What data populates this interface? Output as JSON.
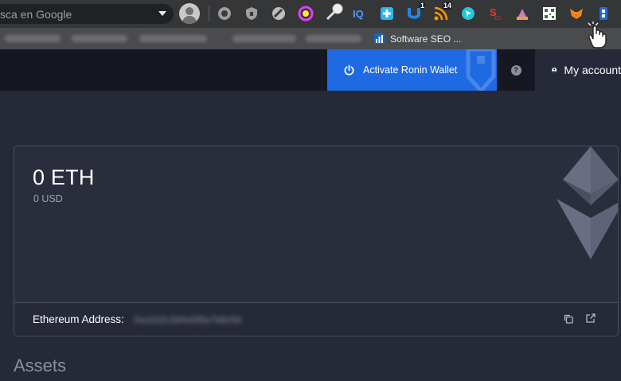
{
  "browser": {
    "search_placeholder": "sca en Google",
    "extension_badges": {
      "ext_u": "1",
      "ext_rss": "14"
    },
    "bookmark_label": "Software SEO ..."
  },
  "header": {
    "activate_ronin_label": "Activate Ronin Wallet",
    "help_label": "?",
    "account_label": "My account"
  },
  "balance": {
    "eth": "0 ETH",
    "usd": "0 USD"
  },
  "address": {
    "label": "Ethereum Address:",
    "value": "0xa1b2c3d4e5f6a7b8c9d"
  },
  "assets_title": "Assets",
  "colors": {
    "accent": "#1f6ae3",
    "background": "#262938",
    "header": "#151722"
  }
}
